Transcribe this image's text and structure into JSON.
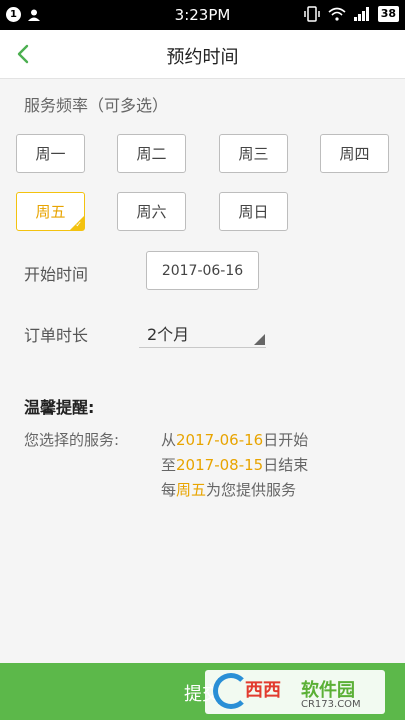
{
  "status_bar": {
    "notification_count": "1",
    "time": "3:23PM",
    "battery": "38"
  },
  "header": {
    "title": "预约时间",
    "back_icon": "chevron-left-icon"
  },
  "frequency": {
    "label": "服务频率（可多选）",
    "days": [
      "周一",
      "周二",
      "周三",
      "周四",
      "周五",
      "周六",
      "周日"
    ],
    "selected": "周五"
  },
  "start_time": {
    "label": "开始时间",
    "value": "2017-06-16"
  },
  "duration": {
    "label": "订单时长",
    "value": "2个月"
  },
  "reminder": {
    "title": "温馨提醒:",
    "label": "您选择的服务:",
    "line1_prefix": "从",
    "line1_date": "2017-06-16",
    "line1_suffix": "日开始",
    "line2_prefix": "至",
    "line2_date": "2017-08-15",
    "line2_suffix": "日结束",
    "line3_prefix": "每",
    "line3_day": "周五",
    "line3_suffix": "为您提供服务"
  },
  "submit": {
    "label": "提交"
  },
  "watermark": {
    "brand_red": "西西",
    "brand_green": "软件园",
    "site": "CR173.COM"
  },
  "colors": {
    "accent_green": "#5cb84a",
    "highlight_orange": "#e8a400",
    "selected_border": "#f3c20f"
  }
}
